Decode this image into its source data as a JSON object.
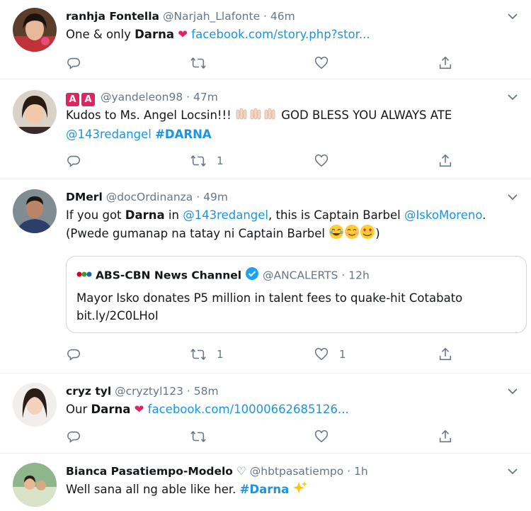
{
  "colors": {
    "link": "#1b95e0",
    "muted": "#657786",
    "heart": "#e0245e",
    "border": "#e6ecf0"
  },
  "tweets": [
    {
      "name": "ranhja Fontella",
      "handle": "@Narjah_Llafonte",
      "time": "46m",
      "text_before": "One & only",
      "bold": "Darna",
      "link": "facebook.com/story.php?stor...",
      "retweets": "",
      "likes": ""
    },
    {
      "name_badge_1": "A",
      "name_badge_2": "A",
      "handle": "@yandeleon98",
      "time": "47m",
      "line1": "Kudos to Ms. Angel Locsin!!!",
      "line1_after": "GOD BLESS YOU ALWAYS ATE",
      "mention": "@143redangel",
      "hashtag": "#DARNA",
      "retweets": "1",
      "likes": ""
    },
    {
      "name": "DMerl",
      "handle": "@docOrdinanza",
      "time": "49m",
      "line1_a": "If you got",
      "line1_bold": "Darna",
      "line1_b": "in",
      "mention1": "@143redangel",
      "line1_c": ", this is Captain Barbel",
      "mention2": "@IskoMoreno",
      "line1_d": ".",
      "line2": "(Pwede gumanap na tatay ni Captain Barbel",
      "line2_end": ")",
      "quote": {
        "name": "ABS-CBN News Channel",
        "handle": "@ANCALERTS",
        "time": "12h",
        "text": "Mayor Isko donates P5 million in talent fees to quake-hit Cotabato",
        "link": "bit.ly/2C0LHoI"
      },
      "retweets": "1",
      "likes": "1"
    },
    {
      "name": "cryz tyl",
      "handle": "@cryztyl123",
      "time": "58m",
      "text_before": "Our",
      "bold": "Darna",
      "link": "facebook.com/10000662685126...",
      "retweets": "",
      "likes": ""
    },
    {
      "name": "Bianca Pasatiempo-Modelo",
      "name_suffix": "♡",
      "handle": "@hbtpasatiempo",
      "time": "1h",
      "text_before": "Well sana all ng able like her.",
      "hashtag": "#Darna"
    }
  ],
  "separator": "·"
}
